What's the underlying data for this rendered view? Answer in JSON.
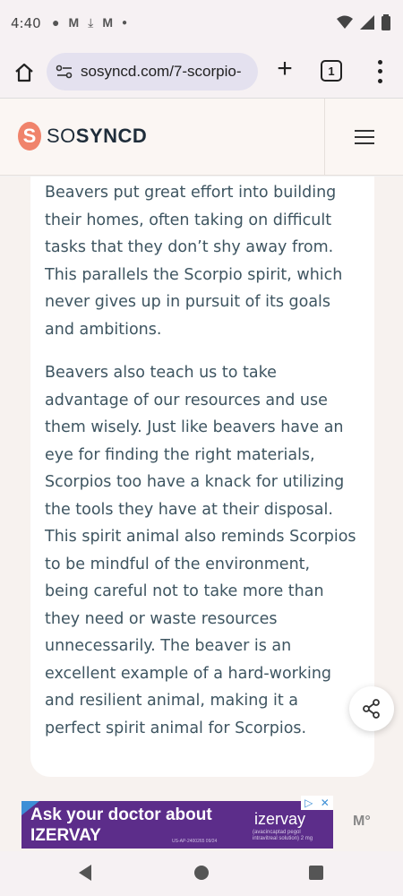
{
  "status_bar": {
    "time": "4:40",
    "left_icons": [
      "chat-icon",
      "gmail-icon",
      "download-icon",
      "gmail-icon",
      "dot-icon"
    ],
    "right_icons": [
      "wifi-icon",
      "signal-icon",
      "battery-icon"
    ]
  },
  "browser": {
    "url": "sosyncd.com/7-scorpio-",
    "tab_count": "1"
  },
  "site": {
    "logo_letter": "S",
    "logo_so": "SO",
    "logo_sync": "SYNCD"
  },
  "article": {
    "paragraphs": [
      "Beavers put great effort into building their homes, often taking on difficult tasks that they don’t shy away from. This parallels the Scorpio spirit, which never gives up in pursuit of its goals and ambitions.",
      "Beavers also teach us to take advantage of our resources and use them wisely. Just like beavers have an eye for finding the right materials, Scorpios too have a knack for utilizing the tools they have at their disposal. This spirit animal also reminds Scorpios to be mindful of the environment, being careful not to take more than they need or waste resources unnecessarily. The beaver is an excellent example of a hard-working and resilient animal, making it a perfect spirit animal for Scorpios."
    ]
  },
  "ad": {
    "line1": "Ask your doctor about",
    "line2": "IZERVAY",
    "brand": "izervay",
    "brand_sub": "(avacincaptad pegol intravitreal solution) 2 mg",
    "code": "US-AP-2400265 09/24",
    "side_logo": "M°",
    "colors": {
      "background": "#5c2d8a",
      "choices": "#3d8fd6"
    }
  },
  "colors": {
    "logo_accent": "#f0836b",
    "text": "#3e5561",
    "header_bg": "#fbf6f3"
  }
}
